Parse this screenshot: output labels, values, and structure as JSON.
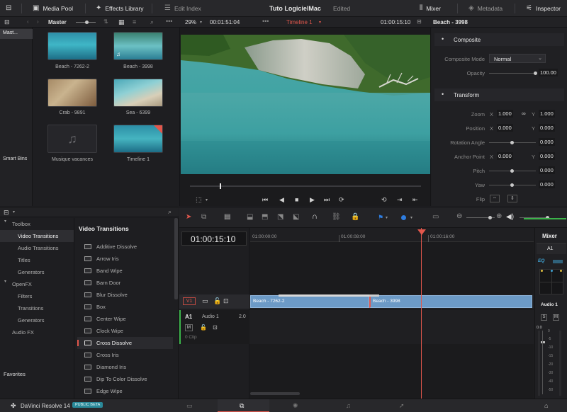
{
  "topbar": {
    "media_pool": "Media Pool",
    "effects_library": "Effects Library",
    "edit_index": "Edit Index",
    "project_title": "Tuto LogicielMac",
    "project_status": "Edited",
    "mixer": "Mixer",
    "metadata": "Metadata",
    "inspector": "Inspector"
  },
  "media_pool": {
    "bin_label": "Master",
    "master_bin": "Mast...",
    "smart_bins": "Smart Bins",
    "clips": [
      {
        "name": "Beach - 7262-2"
      },
      {
        "name": "Beach - 3998"
      },
      {
        "name": "Crab - 9891"
      },
      {
        "name": "Sea - 6399"
      },
      {
        "name": "Musique vacances"
      },
      {
        "name": "Timeline 1"
      }
    ]
  },
  "viewer": {
    "zoom": "29%",
    "duration": "00:01:51:04",
    "timeline_name": "Timeline 1",
    "timecode": "01:00:15:10"
  },
  "inspector": {
    "clip_name": "Beach - 3998",
    "composite_header": "Composite",
    "composite_mode_label": "Composite Mode",
    "composite_mode_value": "Normal",
    "opacity_label": "Opacity",
    "opacity_value": "100.00",
    "transform_header": "Transform",
    "zoom_label": "Zoom",
    "zoom_x": "1.000",
    "zoom_y": "1.000",
    "position_label": "Position",
    "position_x": "0.000",
    "position_y": "0.000",
    "rotation_label": "Rotation Angle",
    "rotation_value": "0.000",
    "anchor_label": "Anchor Point",
    "anchor_x": "0.000",
    "anchor_y": "0.000",
    "pitch_label": "Pitch",
    "pitch_value": "0.000",
    "yaw_label": "Yaw",
    "yaw_value": "0.000",
    "flip_label": "Flip",
    "x_axis": "X",
    "y_axis": "Y"
  },
  "effects": {
    "toolbox": "Toolbox",
    "video_transitions": "Video Transitions",
    "audio_transitions": "Audio Transitions",
    "titles": "Titles",
    "generators": "Generators",
    "openfx": "OpenFX",
    "filters": "Filters",
    "transitions": "Transitions",
    "openfx_generators": "Generators",
    "audio_fx": "Audio FX",
    "favorites": "Favorites",
    "list_header": "Video Transitions",
    "list": [
      "Additive Dissolve",
      "Arrow Iris",
      "Band Wipe",
      "Barn Door",
      "Blur Dissolve",
      "Box",
      "Center Wipe",
      "Clock Wipe",
      "Cross Dissolve",
      "Cross Iris",
      "Diamond Iris",
      "Dip To Color Dissolve",
      "Edge Wipe"
    ]
  },
  "timeline": {
    "timecode": "01:00:15:10",
    "ruler": [
      "01:00:00:00",
      "01:00:08:00",
      "01:00:16:00"
    ],
    "v1": "V1",
    "a1": "A1",
    "audio_track_name": "Audio 1",
    "audio_channels": "2.0",
    "audio_clip_count": "0 Clip",
    "mute": "M",
    "clip1": "Beach - 7262-2",
    "clip2": "Beach - 3998"
  },
  "mixer": {
    "title": "Mixer",
    "channel": "A1",
    "eq": "EQ",
    "bus_name": "Audio 1",
    "solo": "S",
    "mute": "M",
    "meter_top": "0.0",
    "scale": [
      "0",
      "-5",
      "-10",
      "-15",
      "-20",
      "-30",
      "-40",
      "-50"
    ]
  },
  "bottombar": {
    "app_name": "DaVinci Resolve 14",
    "badge": "PUBLIC BETA"
  }
}
